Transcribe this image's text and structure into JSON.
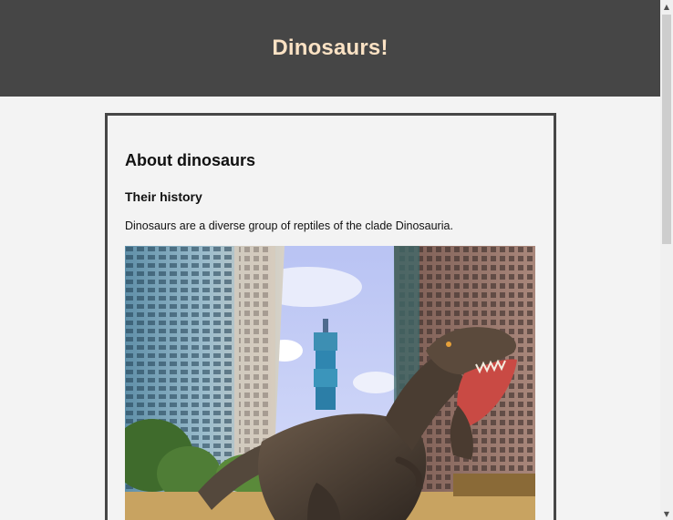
{
  "header": {
    "title": "Dinosaurs!"
  },
  "article": {
    "heading": "About dinosaurs",
    "subheading": "Their history",
    "paragraph": "Dinosaurs are a diverse group of reptiles of the clade Dinosauria.",
    "image": {
      "subject": "tyrannosaurus-model-in-city",
      "alt_hint": "dinosaur statue among skyscrapers"
    }
  },
  "colors": {
    "header_bg": "#464646",
    "title_text": "#fbe2c4",
    "page_bg": "#f3f3f3",
    "border": "#464646"
  },
  "scrollbar": {
    "up_icon": "triangle-up-icon",
    "down_icon": "triangle-down-icon"
  }
}
